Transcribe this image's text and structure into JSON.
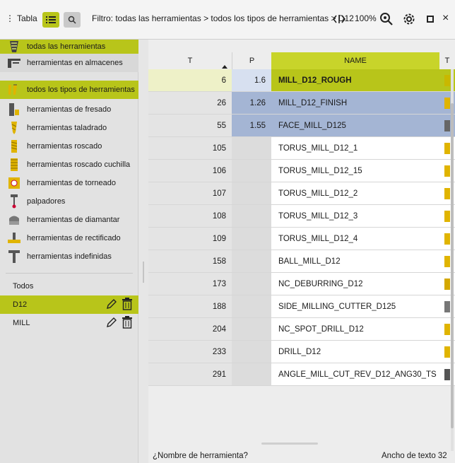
{
  "toolbar": {
    "menu_label": "Tabla",
    "filter_text": "Filtro: todas las herramientas > todos los tipos de herramientas > D12",
    "zoom": "100%"
  },
  "sidebar": {
    "groups": [
      {
        "label": "todas las herramientas",
        "icon": "all-tools-icon",
        "selected": true
      },
      {
        "label": "herramientas en almacenes",
        "icon": "tool-magazine-icon",
        "selected": false
      }
    ],
    "types": [
      {
        "label": "todos los tipos de herramientas",
        "icon": "all-tool-types-icon",
        "selected": true
      },
      {
        "label": "herramientas de fresado",
        "icon": "milling-tool-icon"
      },
      {
        "label": "herramientas taladrado",
        "icon": "drilling-tool-icon"
      },
      {
        "label": "herramientas roscado",
        "icon": "tapping-tool-icon"
      },
      {
        "label": "herramientas roscado cuchilla",
        "icon": "thread-mill-icon"
      },
      {
        "label": "herramientas de torneado",
        "icon": "turning-tool-icon"
      },
      {
        "label": "palpadores",
        "icon": "touch-probe-icon"
      },
      {
        "label": "herramientas de diamantar",
        "icon": "dressing-tool-icon"
      },
      {
        "label": "herramientas de rectificado",
        "icon": "grinding-tool-icon"
      },
      {
        "label": "herramientas indefinidas",
        "icon": "undefined-tool-icon"
      }
    ],
    "filters": [
      {
        "label": "Todos",
        "selected": false,
        "editable": false
      },
      {
        "label": "D12",
        "selected": true,
        "editable": true
      },
      {
        "label": "MILL",
        "selected": false,
        "editable": true
      }
    ]
  },
  "table": {
    "columns": [
      "T",
      "P",
      "NAME",
      "T"
    ],
    "rows": [
      {
        "t": "6",
        "p": "1.6",
        "name": "MILL_D12_ROUGH",
        "state": "highlight"
      },
      {
        "t": "26",
        "p": "1.26",
        "name": "MILL_D12_FINISH",
        "state": "blue"
      },
      {
        "t": "55",
        "p": "1.55",
        "name": "FACE_MILL_D125",
        "state": "blue"
      },
      {
        "t": "105",
        "p": "",
        "name": "TORUS_MILL_D12_1",
        "state": ""
      },
      {
        "t": "106",
        "p": "",
        "name": "TORUS_MILL_D12_15",
        "state": ""
      },
      {
        "t": "107",
        "p": "",
        "name": "TORUS_MILL_D12_2",
        "state": ""
      },
      {
        "t": "108",
        "p": "",
        "name": "TORUS_MILL_D12_3",
        "state": ""
      },
      {
        "t": "109",
        "p": "",
        "name": "TORUS_MILL_D12_4",
        "state": ""
      },
      {
        "t": "158",
        "p": "",
        "name": "BALL_MILL_D12",
        "state": ""
      },
      {
        "t": "173",
        "p": "",
        "name": "NC_DEBURRING_D12",
        "state": ""
      },
      {
        "t": "188",
        "p": "",
        "name": "SIDE_MILLING_CUTTER_D125",
        "state": ""
      },
      {
        "t": "204",
        "p": "",
        "name": "NC_SPOT_DRILL_D12",
        "state": ""
      },
      {
        "t": "233",
        "p": "",
        "name": "DRILL_D12",
        "state": ""
      },
      {
        "t": "291",
        "p": "",
        "name": "ANGLE_MILL_CUT_REV_D12_ANG30_TS",
        "state": ""
      }
    ]
  },
  "footer": {
    "left": "¿Nombre de herramienta?",
    "right": "Ancho de texto 32"
  },
  "colors": {
    "accent": "#b8c51a",
    "selection_blue": "#a4b5d4"
  }
}
